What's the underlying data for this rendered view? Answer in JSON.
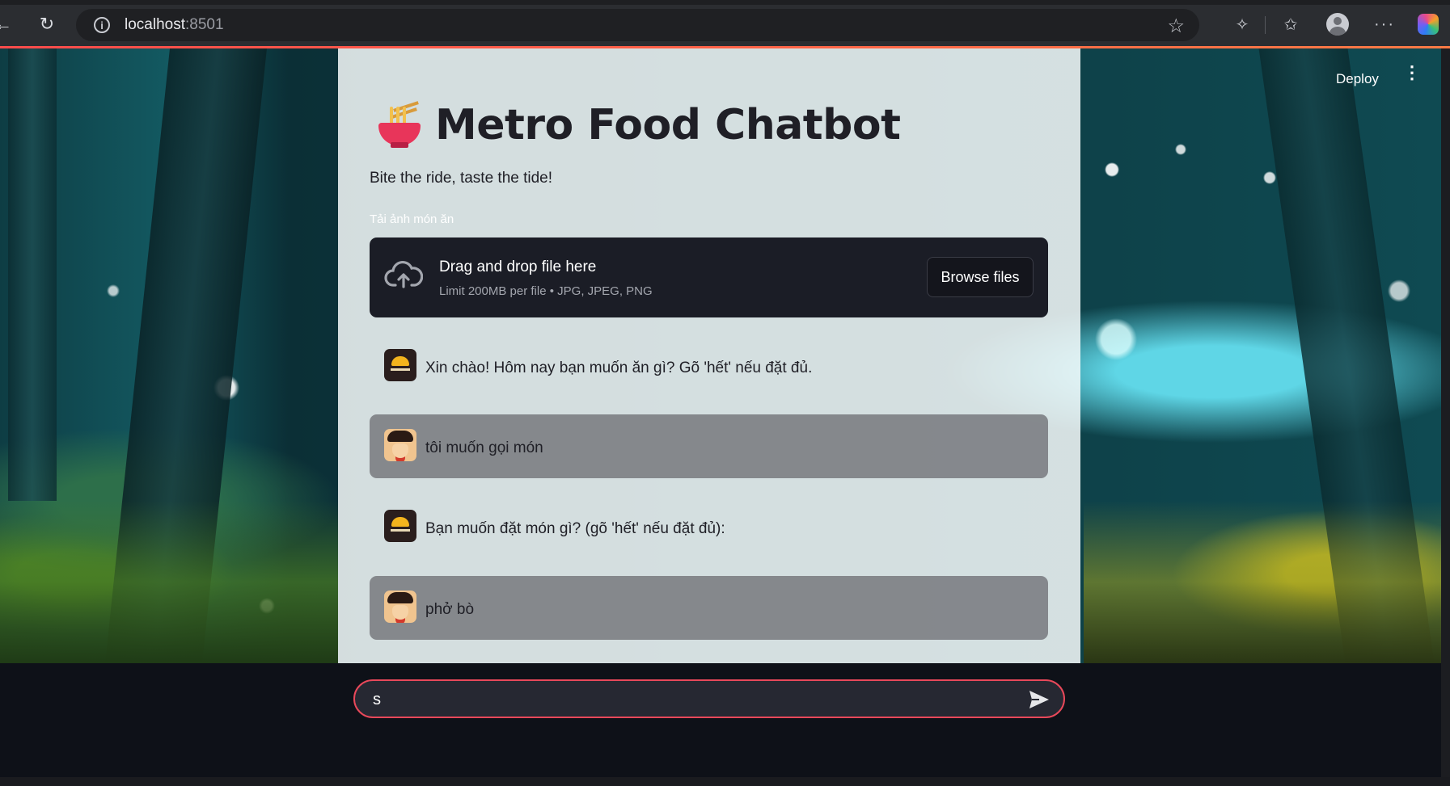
{
  "browser": {
    "url_host": "localhost",
    "url_port": ":8501",
    "icons": [
      "back-icon",
      "reload-icon",
      "info-icon",
      "star-icon",
      "extensions-icon",
      "favorites-icon",
      "profile-icon",
      "more-icon",
      "copilot-icon"
    ]
  },
  "app": {
    "deploy_label": "Deploy",
    "menu_glyph": "⋮",
    "title_emoji_icon": "ramen-bowl-icon",
    "title": "Metro Food Chatbot",
    "subtitle": "Bite the ride, taste the tide!",
    "uploader": {
      "label": "Tải ảnh món ăn",
      "dropzone_title": "Drag and drop file here",
      "limit_text": "Limit 200MB per file • JPG, JPEG, PNG",
      "browse_label": "Browse files"
    },
    "messages": [
      {
        "role": "assistant",
        "text": "Xin chào! Hôm nay bạn muốn ăn gì? Gõ 'hết' nếu đặt đủ."
      },
      {
        "role": "user",
        "text": "tôi muốn gọi món"
      },
      {
        "role": "assistant",
        "text": "Bạn muốn đặt món gì? (gõ 'hết' nếu đặt đủ):"
      },
      {
        "role": "user",
        "text": "phở bò"
      }
    ],
    "chat_input": {
      "value": "s"
    },
    "colors": {
      "accent": "#ff4b4b",
      "uploader_bg": "#1b1d26",
      "bottom_bg": "#0e1118"
    }
  }
}
